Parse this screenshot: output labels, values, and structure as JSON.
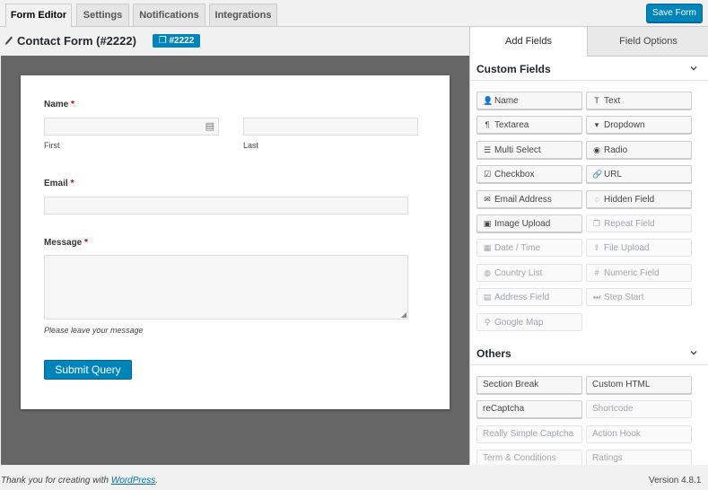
{
  "tabs": [
    {
      "label": "Form Editor",
      "active": true
    },
    {
      "label": "Settings",
      "active": false
    },
    {
      "label": "Notifications",
      "active": false
    },
    {
      "label": "Integrations",
      "active": false
    }
  ],
  "save_label": "Save Form",
  "form": {
    "title": "Contact Form (#2222)",
    "id_badge": "#2222"
  },
  "preview": {
    "name_label": "Name",
    "first_sub": "First",
    "last_sub": "Last",
    "email_label": "Email",
    "message_label": "Message",
    "required_mark": "*",
    "message_help": "Please leave your message",
    "submit_label": "Submit Query"
  },
  "panel": {
    "tab_add": "Add Fields",
    "tab_options": "Field Options",
    "custom_title": "Custom Fields",
    "others_title": "Others",
    "custom_fields": [
      {
        "label": "Name",
        "icon": "user-icon",
        "glyph": "👤",
        "disabled": false
      },
      {
        "label": "Text",
        "icon": "text-icon",
        "glyph": "T",
        "disabled": false
      },
      {
        "label": "Textarea",
        "icon": "paragraph-icon",
        "glyph": "¶",
        "disabled": false
      },
      {
        "label": "Dropdown",
        "icon": "dropdown-icon",
        "glyph": "▾",
        "disabled": false
      },
      {
        "label": "Multi Select",
        "icon": "list-icon",
        "glyph": "☰",
        "disabled": false
      },
      {
        "label": "Radio",
        "icon": "radio-icon",
        "glyph": "◉",
        "disabled": false
      },
      {
        "label": "Checkbox",
        "icon": "checkbox-icon",
        "glyph": "☑",
        "disabled": false
      },
      {
        "label": "URL",
        "icon": "link-icon",
        "glyph": "🔗",
        "disabled": false
      },
      {
        "label": "Email Address",
        "icon": "envelope-icon",
        "glyph": "✉",
        "disabled": false
      },
      {
        "label": "Hidden Field",
        "icon": "eye-slash-icon",
        "glyph": "◌",
        "disabled": false
      },
      {
        "label": "Image Upload",
        "icon": "image-icon",
        "glyph": "▣",
        "disabled": false
      },
      {
        "label": "Repeat Field",
        "icon": "clone-icon",
        "glyph": "❐",
        "disabled": true
      },
      {
        "label": "Date / Time",
        "icon": "calendar-icon",
        "glyph": "▦",
        "disabled": true
      },
      {
        "label": "File Upload",
        "icon": "upload-icon",
        "glyph": "⇪",
        "disabled": true
      },
      {
        "label": "Country List",
        "icon": "globe-icon",
        "glyph": "◍",
        "disabled": true
      },
      {
        "label": "Numeric Field",
        "icon": "hash-icon",
        "glyph": "#",
        "disabled": true
      },
      {
        "label": "Address Field",
        "icon": "address-card-icon",
        "glyph": "▤",
        "disabled": true
      },
      {
        "label": "Step Start",
        "icon": "step-forward-icon",
        "glyph": "⏭",
        "disabled": true
      },
      {
        "label": "Google Map",
        "icon": "map-marker-icon",
        "glyph": "⚲",
        "disabled": true
      }
    ],
    "others": [
      {
        "label": "Section Break",
        "disabled": false
      },
      {
        "label": "Custom HTML",
        "disabled": false
      },
      {
        "label": "reCaptcha",
        "disabled": false
      },
      {
        "label": "Shortcode",
        "disabled": true
      },
      {
        "label": "Really Simple Captcha",
        "disabled": true
      },
      {
        "label": "Action Hook",
        "disabled": true
      },
      {
        "label": "Term & Conditions",
        "disabled": true
      },
      {
        "label": "Ratings",
        "disabled": true
      }
    ]
  },
  "footer": {
    "thanks_prefix": "Thank you for creating with ",
    "link_text": "WordPress",
    "thanks_suffix": ".",
    "version": "Version 4.8.1"
  }
}
